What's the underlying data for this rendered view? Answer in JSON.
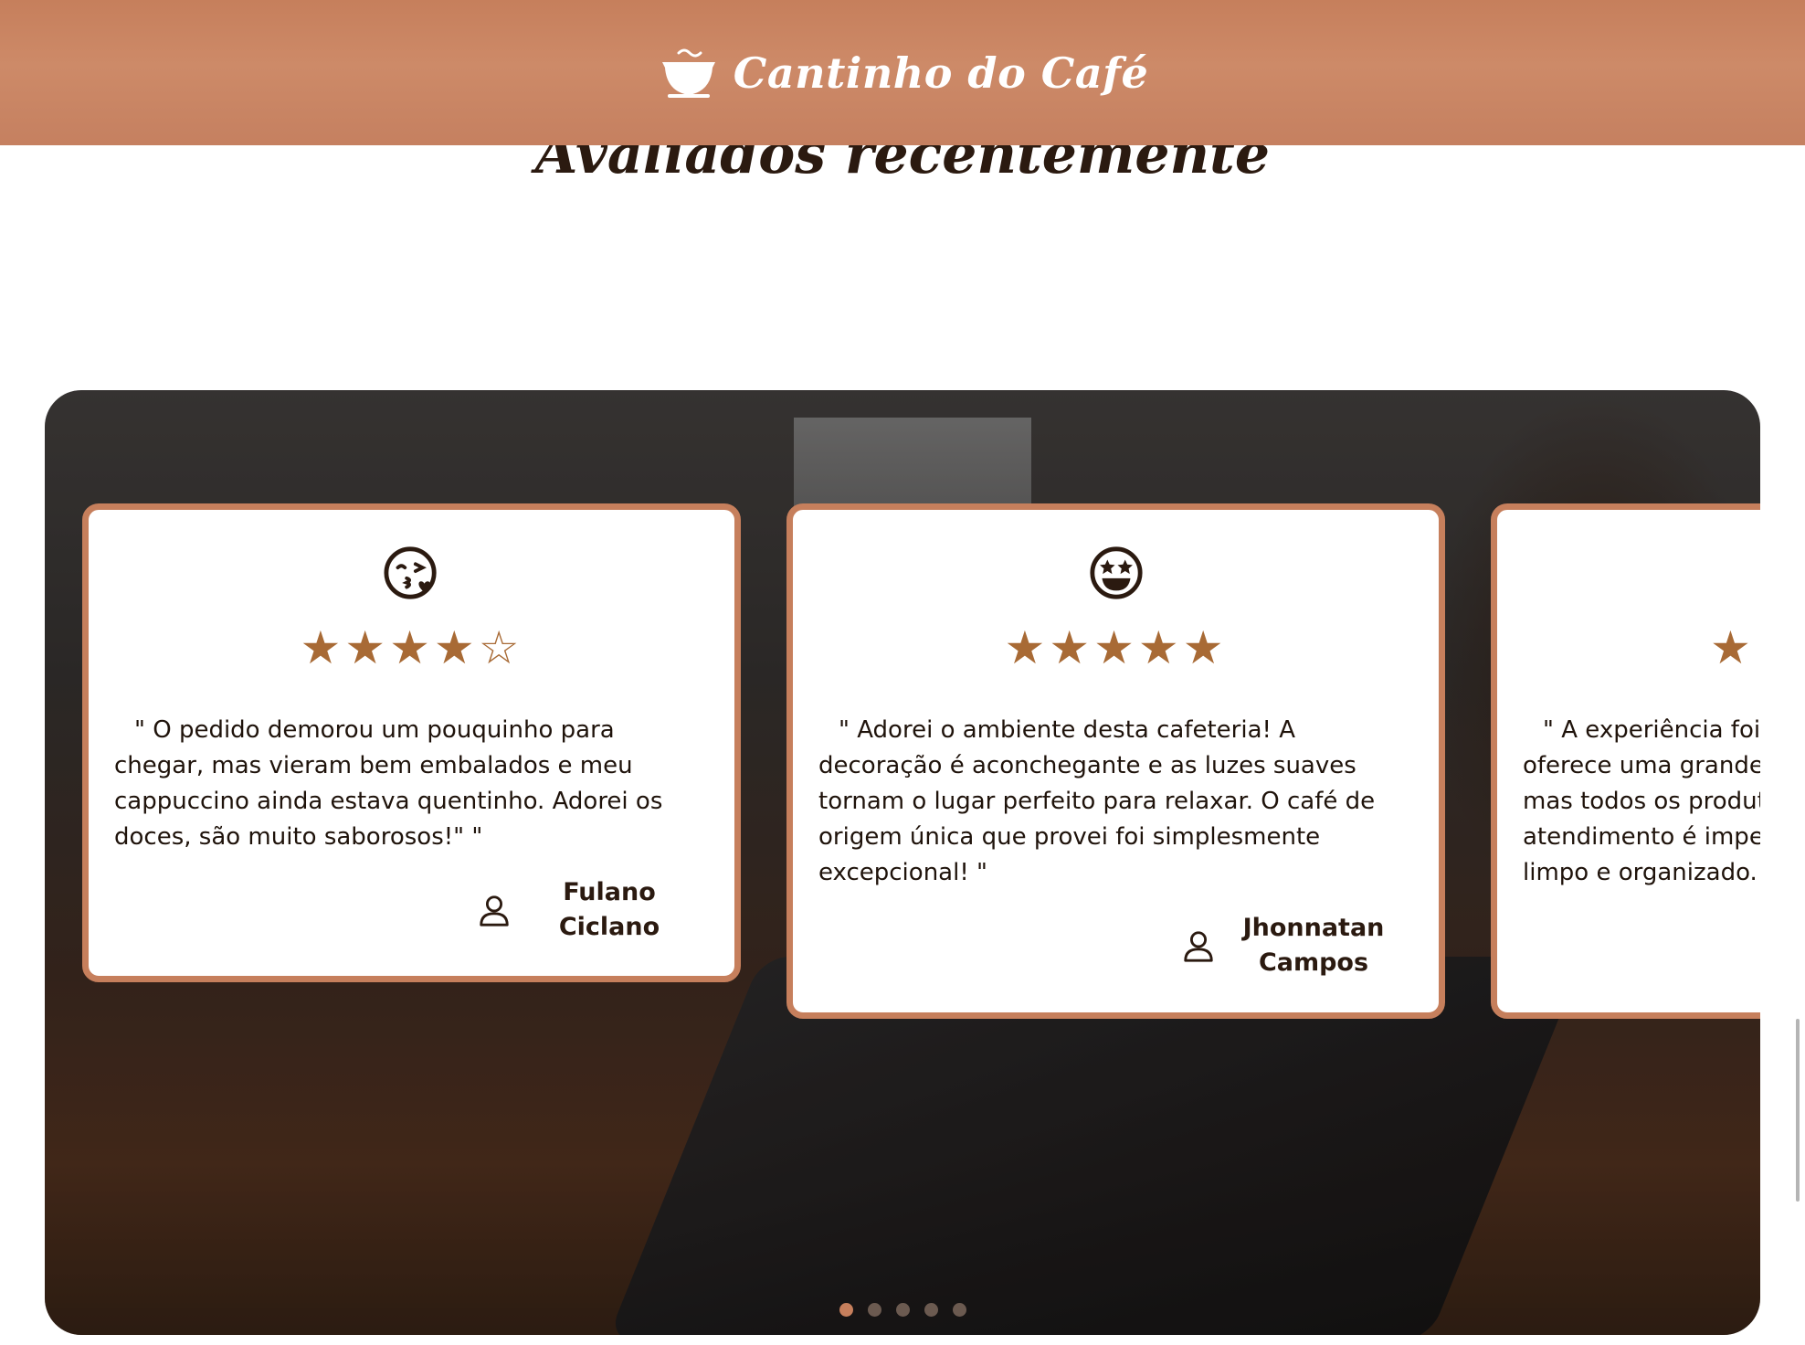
{
  "header": {
    "brand_name": "Cantinho do Café"
  },
  "section": {
    "title": "Avaliados recentemente"
  },
  "reviews": [
    {
      "emoji": "kissing-face-icon",
      "rating": 4,
      "stars": "★★★★☆",
      "quote": "\" O pedido demorou um pouquinho para chegar, mas vieram bem embalados e meu cappuccino ainda estava quentinho. Adorei os doces, são muito saborosos!\" \"",
      "author_line1": "Fulano",
      "author_line2": "Ciclano"
    },
    {
      "emoji": "star-struck-face-icon",
      "rating": 5,
      "stars": "★★★★★",
      "quote": "\" Adorei o ambiente desta cafeteria! A decoração é aconchegante e as luzes suaves tornam o lugar perfeito para relaxar. O café de origem única que provei foi simplesmente excepcional! \"",
      "author_line1": "Jhonnatan",
      "author_line2": "Campos"
    },
    {
      "stars": "★",
      "quote_lines": [
        "\" A experiência foi",
        "oferece uma grande",
        "mas todos os produt",
        "atendimento é impec",
        "limpo e organizado. \""
      ]
    }
  ],
  "pagination": {
    "count": 5,
    "active": 0
  },
  "colors": {
    "brand": "#c67f5c",
    "star": "#a86a35",
    "text": "#2b1a10"
  }
}
